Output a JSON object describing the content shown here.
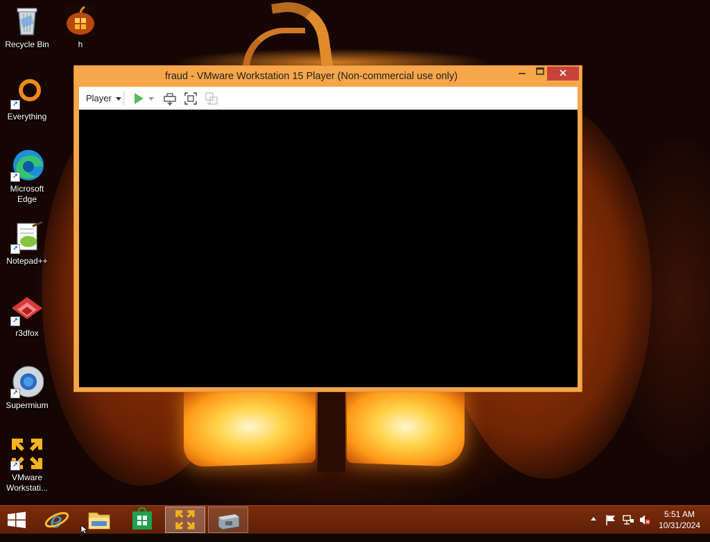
{
  "desktop": {
    "icons": [
      {
        "label": "Recycle Bin",
        "icon": "recycle-bin-icon"
      },
      {
        "label": "h",
        "icon": "pumpkin-image-icon"
      },
      {
        "label": "Everything",
        "icon": "everything-search-icon"
      },
      {
        "label": "Microsoft Edge",
        "icon": "edge-icon"
      },
      {
        "label": "Notepad++",
        "icon": "notepadpp-icon"
      },
      {
        "label": "r3dfox",
        "icon": "r3dfox-icon"
      },
      {
        "label": "Supermium",
        "icon": "supermium-icon"
      },
      {
        "label": "VMware Workstati...",
        "icon": "vmware-icon"
      }
    ]
  },
  "vm_window": {
    "title": "fraud - VMware Workstation 15 Player (Non-commercial use only)",
    "player_menu": "Player",
    "colors": {
      "frame": "#f7a64a",
      "close": "#c7433a",
      "screen": "#000000"
    }
  },
  "taskbar": {
    "clock_time": "5:51 AM",
    "clock_date": "10/31/2024",
    "items": [
      {
        "name": "start",
        "icon": "windows-start-icon"
      },
      {
        "name": "internet-explorer",
        "icon": "ie-icon"
      },
      {
        "name": "file-explorer",
        "icon": "folder-icon"
      },
      {
        "name": "store",
        "icon": "store-icon"
      },
      {
        "name": "vmware-player",
        "icon": "vmware-icon",
        "active": true
      },
      {
        "name": "installer",
        "icon": "installer-icon"
      }
    ],
    "tray": [
      "show-hidden-icons",
      "action-center-flag-icon",
      "network-icon",
      "volume-muted-icon"
    ]
  }
}
